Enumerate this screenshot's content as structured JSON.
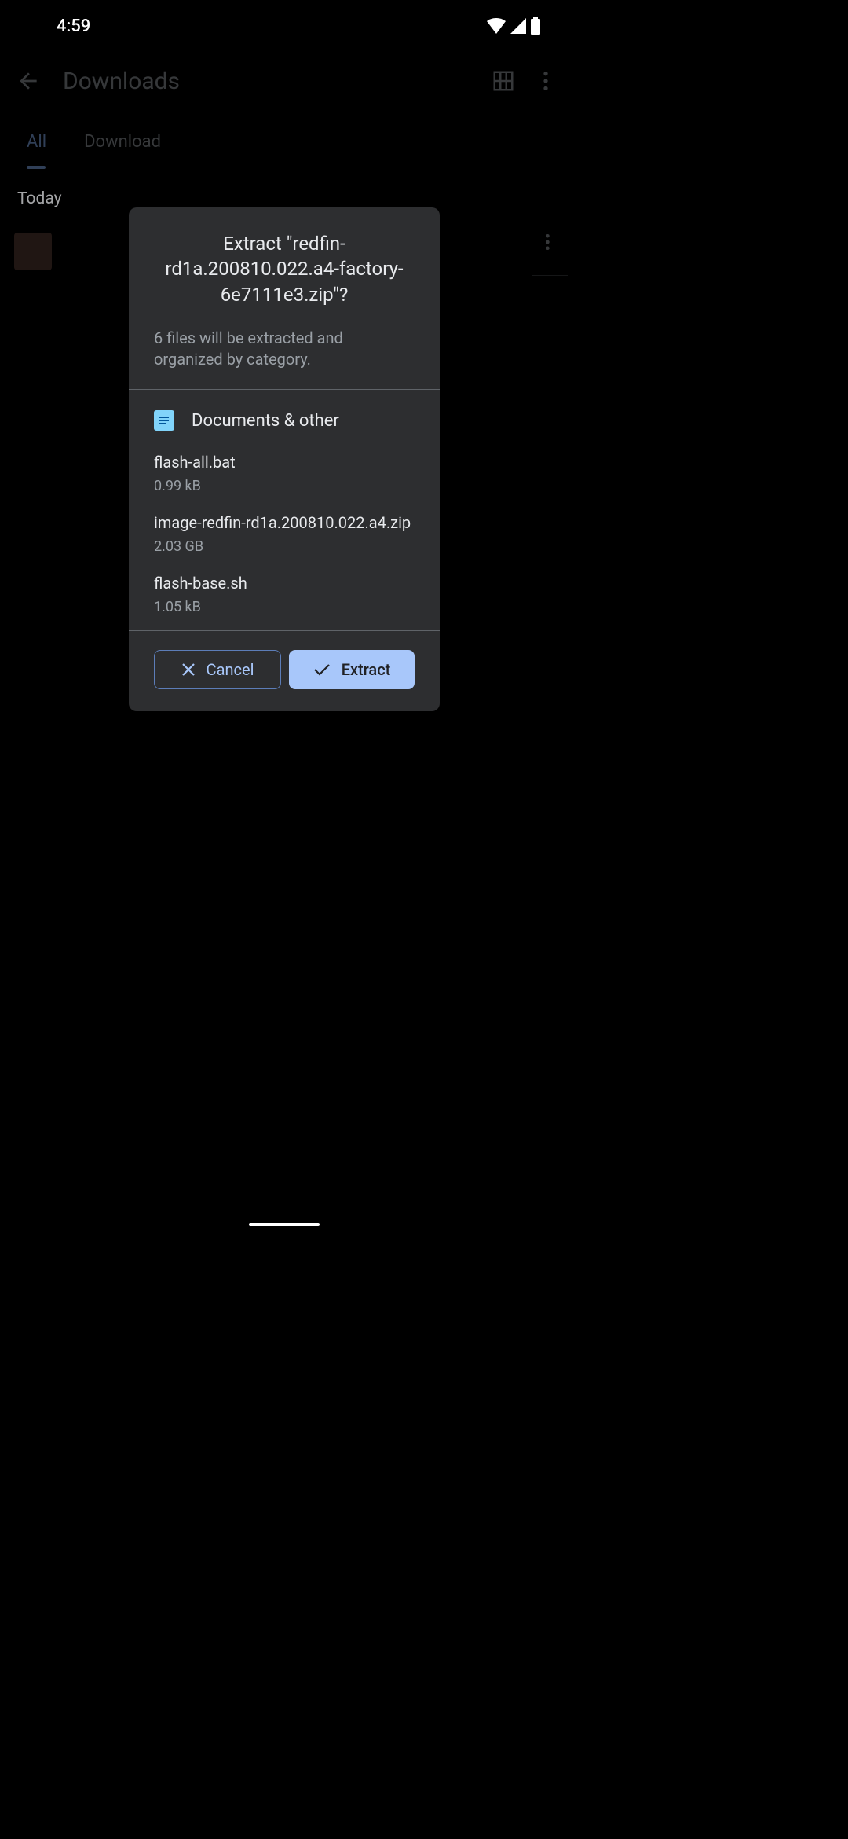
{
  "statusBar": {
    "time": "4:59"
  },
  "header": {
    "title": "Downloads"
  },
  "tabs": {
    "all": "All",
    "download": "Download"
  },
  "sectionHeader": "Today",
  "dialog": {
    "title": "Extract \"redfin-rd1a.200810.022.a4-factory-6e7111e3.zip\"?",
    "subtitle": "6 files will be extracted and organized by category.",
    "category": "Documents & other",
    "files": [
      {
        "name": "flash-all.bat",
        "size": "0.99 kB"
      },
      {
        "name": "image-redfin-rd1a.200810.022.a4.zip",
        "size": "2.03 GB"
      },
      {
        "name": "flash-base.sh",
        "size": "1.05 kB"
      }
    ],
    "cancelLabel": "Cancel",
    "extractLabel": "Extract"
  }
}
